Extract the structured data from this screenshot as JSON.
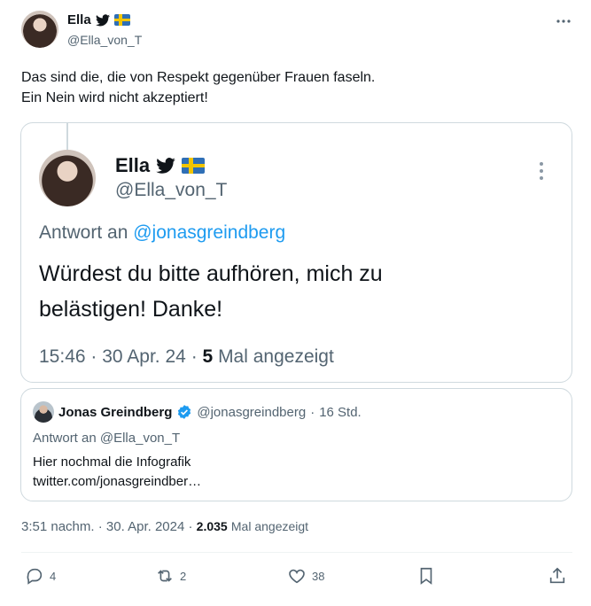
{
  "post": {
    "author_name": "Ella",
    "author_handle": "@Ella_von_T",
    "text_line1": "Das sind die, die von Respekt gegenüber Frauen faseln.",
    "text_line2": "Ein Nein wird nicht akzeptiert!",
    "time": "3:51 nachm.",
    "date": "30. Apr. 2024",
    "view_count": "2.035",
    "views_label": "Mal angezeigt",
    "sep": "·"
  },
  "embedded_image": {
    "author_name": "Ella",
    "author_handle": "@Ella_von_T",
    "reply_prefix": "Antwort an",
    "reply_to": "@jonasgreindberg",
    "text_line1": "Würdest du bitte aufhören, mich zu",
    "text_line2": "belästigen! Danke!",
    "time": "15:46",
    "date": "30 Apr. 24",
    "view_count": "5",
    "views_label": "Mal angezeigt",
    "sep": "·"
  },
  "quoted": {
    "author_name": "Jonas Greindberg",
    "author_handle": "@jonasgreindberg",
    "time_ago": "16 Std.",
    "sep": "·",
    "reply_line": "Antwort an @Ella_von_T",
    "text_line1": "Hier nochmal die Infografik",
    "text_line2": "twitter.com/jonasgreindber…"
  },
  "actions": {
    "replies": "4",
    "reposts": "2",
    "likes": "38"
  },
  "colors": {
    "text": "#0f1419",
    "muted": "#536471",
    "link": "#1d9bf0",
    "border": "#cfd9de"
  }
}
